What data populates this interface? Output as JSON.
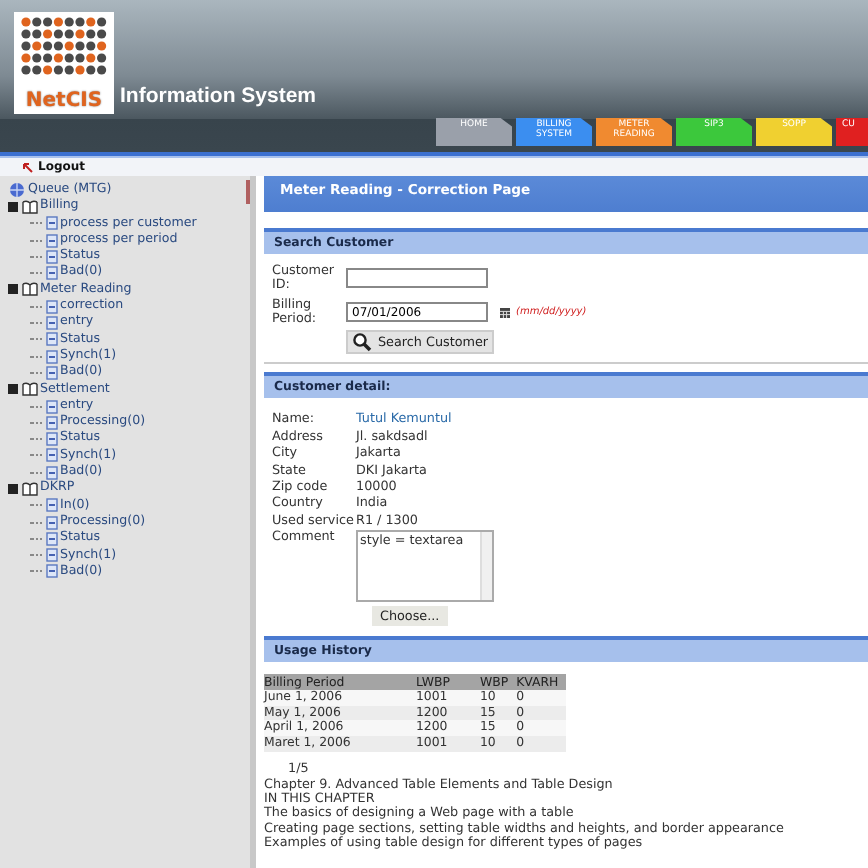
{
  "header": {
    "logo_text": "NetCIS",
    "title": "Information System"
  },
  "tabs": [
    {
      "label": "HOME",
      "color": "#9aa0aa"
    },
    {
      "label": "BILLING SYSTEM",
      "color": "#3b8ef0"
    },
    {
      "label": "METER READING",
      "color": "#f08a30"
    },
    {
      "label": "SIP3",
      "color": "#3cc83c"
    },
    {
      "label": "SOPP",
      "color": "#f0d030"
    },
    {
      "label": "CU",
      "color": "#e02020"
    }
  ],
  "logout": "Logout",
  "tree": {
    "label": "Queue (MTG)",
    "children": [
      {
        "label": "Billing",
        "children": [
          {
            "label": "process per customer"
          },
          {
            "label": "process per period"
          },
          {
            "label": "Status"
          },
          {
            "label": "Bad(0)"
          }
        ]
      },
      {
        "label": "Meter Reading",
        "children": [
          {
            "label": "correction"
          },
          {
            "label": "entry"
          },
          {
            "label": "Status"
          },
          {
            "label": "Synch(1)"
          },
          {
            "label": "Bad(0)"
          }
        ]
      },
      {
        "label": "Settlement",
        "children": [
          {
            "label": "entry"
          },
          {
            "label": "Processing(0)"
          },
          {
            "label": "Status"
          },
          {
            "label": "Synch(1)"
          },
          {
            "label": "Bad(0)"
          }
        ]
      },
      {
        "label": "DKRP",
        "children": [
          {
            "label": "In(0)"
          },
          {
            "label": "Processing(0)"
          },
          {
            "label": "Status"
          },
          {
            "label": "Synch(1)"
          },
          {
            "label": "Bad(0)"
          }
        ]
      }
    ]
  },
  "page_title": "Meter Reading - Correction Page",
  "search": {
    "heading": "Search Customer",
    "customer_id": {
      "label": "Customer ID:"
    },
    "billing_period": {
      "label": "Billing Period:",
      "value": "07/01/2006",
      "hint": "(mm/dd/yyyy)"
    },
    "button": "Search Customer"
  },
  "detail": {
    "heading": "Customer detail:",
    "rows": [
      {
        "label": "Name:",
        "value": "Tutul Kemuntul",
        "kind": "link"
      },
      {
        "label": "Address",
        "value": "Jl. sakdsadl",
        "kind": "text"
      },
      {
        "label": "City",
        "value": "Jakarta",
        "kind": "text"
      },
      {
        "label": "State",
        "value": "DKI Jakarta",
        "kind": "text"
      },
      {
        "label": "Zip code",
        "value": "10000",
        "kind": "text"
      },
      {
        "label": "Country",
        "value": "India",
        "kind": "text"
      },
      {
        "label": "Used service",
        "value": "R1 / 1300",
        "kind": "text"
      }
    ],
    "comment": {
      "label": "Comment",
      "value": "style = textarea"
    },
    "choose_button": "Choose..."
  },
  "usage": {
    "heading": "Usage History",
    "columns": [
      "Billing Period",
      "LWBP",
      "WBP",
      "KVARH"
    ],
    "rows": [
      [
        "June 1, 2006",
        "1001",
        "10",
        "0"
      ],
      [
        "May 1, 2006",
        "1200",
        "15",
        "0"
      ],
      [
        "April 1, 2006",
        "1200",
        "15",
        "0"
      ],
      [
        "Maret 1, 2006",
        "1001",
        "10",
        "0"
      ]
    ],
    "page": "1/5",
    "lines": [
      "Chapter 9. Advanced Table Elements and Table Design",
      "IN THIS CHAPTER",
      "The basics of designing a Web page with a table",
      "Creating page sections, setting table widths and heights, and border appearance",
      "Examples of using table design for different types of pages"
    ]
  }
}
